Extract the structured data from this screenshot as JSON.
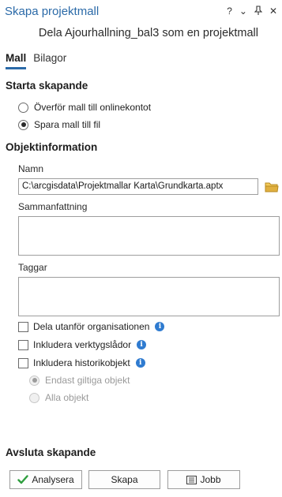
{
  "window": {
    "title": "Skapa projektmall",
    "controls": {
      "help": "?",
      "options": "⌄",
      "pin": "⊥",
      "close": "✕"
    }
  },
  "subtitle": "Dela Ajourhallning_bal3 som en projektmall",
  "tabs": [
    {
      "label": "Mall",
      "active": true
    },
    {
      "label": "Bilagor",
      "active": false
    }
  ],
  "create": {
    "section_title": "Starta skapande",
    "options": [
      {
        "label": "Överför mall till onlinekontot",
        "checked": false
      },
      {
        "label": "Spara mall till fil",
        "checked": true
      }
    ]
  },
  "item_info": {
    "section_title": "Objektinformation",
    "name_label": "Namn",
    "name_value": "C:\\arcgisdata\\Projektmallar Karta\\Grundkarta.aptx",
    "summary_label": "Sammanfattning",
    "summary_value": "",
    "tags_label": "Taggar",
    "tags_value": "",
    "checkboxes": [
      {
        "label": "Dela utanför organisationen",
        "checked": false,
        "info": true
      },
      {
        "label": "Inkludera verktygslådor",
        "checked": false,
        "info": true
      },
      {
        "label": "Inkludera historikobjekt",
        "checked": false,
        "info": true
      }
    ],
    "history_options": [
      {
        "label": "Endast giltiga objekt",
        "checked": true,
        "disabled": true
      },
      {
        "label": "Alla objekt",
        "checked": false,
        "disabled": true
      }
    ]
  },
  "finish": {
    "section_title": "Avsluta skapande",
    "buttons": {
      "analyze": "Analysera",
      "create": "Skapa",
      "job": "Jobb"
    }
  },
  "colors": {
    "accent": "#2b6aa8",
    "info_icon": "#2f7bd0",
    "check_green": "#2e9e3e",
    "folder": "#e0b040"
  }
}
